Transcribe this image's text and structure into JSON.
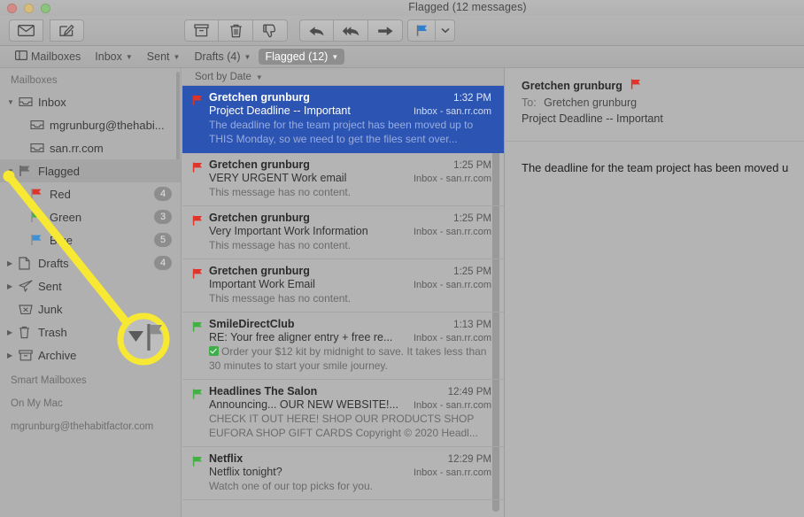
{
  "window": {
    "title": "Flagged (12 messages)",
    "traffic_lights": [
      "close-button",
      "minimize-button",
      "zoom-button"
    ]
  },
  "toolbar": {
    "groups": [
      {
        "name": "mail-actions",
        "buttons": [
          {
            "name": "get-mail-button",
            "icon": "envelope-icon",
            "label": "Get Mail"
          },
          {
            "name": "compose-button",
            "icon": "compose-icon",
            "label": "New Message"
          }
        ]
      },
      {
        "name": "message-actions",
        "buttons": [
          {
            "name": "archive-button",
            "icon": "archive-icon",
            "label": "Archive"
          },
          {
            "name": "delete-button",
            "icon": "trash-icon",
            "label": "Delete"
          },
          {
            "name": "junk-button",
            "icon": "thumbs-down-icon",
            "label": "Junk"
          }
        ]
      },
      {
        "name": "reply-actions",
        "buttons": [
          {
            "name": "reply-button",
            "icon": "reply-arrow-icon",
            "label": "Reply"
          },
          {
            "name": "reply-all-button",
            "icon": "reply-all-arrow-icon",
            "label": "Reply All"
          },
          {
            "name": "forward-button",
            "icon": "forward-arrow-icon",
            "label": "Forward"
          }
        ]
      },
      {
        "name": "flag-actions",
        "buttons": [
          {
            "name": "flag-button",
            "icon": "blue-flag-icon",
            "label": "Flag"
          },
          {
            "name": "flag-dropdown-button",
            "icon": "chevron-down-icon",
            "label": "Flag options"
          }
        ]
      }
    ]
  },
  "favorites_bar": {
    "items": [
      {
        "label": "Mailboxes",
        "icon": "sidebar-toggle-icon",
        "has_chevron": false,
        "active": false
      },
      {
        "label": "Inbox",
        "icon": "",
        "has_chevron": true,
        "active": false
      },
      {
        "label": "Sent",
        "icon": "",
        "has_chevron": true,
        "active": false
      },
      {
        "label": "Drafts (4)",
        "icon": "",
        "has_chevron": true,
        "active": false
      },
      {
        "label": "Flagged (12)",
        "icon": "",
        "has_chevron": true,
        "active": true
      }
    ]
  },
  "sidebar": {
    "header": "Mailboxes",
    "items": [
      {
        "label": "Inbox",
        "icon": "inbox-icon",
        "triangle": "down",
        "indent": 0,
        "badge": "",
        "selected": false
      },
      {
        "label": "mgrunburg@thehabi...",
        "icon": "inbox-icon",
        "triangle": "none",
        "indent": 1,
        "badge": "",
        "selected": false
      },
      {
        "label": "san.rr.com",
        "icon": "inbox-icon",
        "triangle": "none",
        "indent": 1,
        "badge": "",
        "selected": false
      },
      {
        "label": "Flagged",
        "icon": "flag-gray-icon",
        "triangle": "down",
        "indent": 0,
        "badge": "",
        "selected": true
      },
      {
        "label": "Red",
        "icon": "flag-red-icon",
        "triangle": "none",
        "indent": 1,
        "badge": "4",
        "selected": false
      },
      {
        "label": "Green",
        "icon": "flag-green-icon",
        "triangle": "none",
        "indent": 1,
        "badge": "3",
        "selected": false
      },
      {
        "label": "Blue",
        "icon": "flag-blue-icon",
        "triangle": "none",
        "indent": 1,
        "badge": "5",
        "selected": false
      },
      {
        "label": "Drafts",
        "icon": "drafts-icon",
        "triangle": "right",
        "indent": 0,
        "badge": "4",
        "selected": false
      },
      {
        "label": "Sent",
        "icon": "sent-icon",
        "triangle": "right",
        "indent": 0,
        "badge": "",
        "selected": false
      },
      {
        "label": "Junk",
        "icon": "junk-icon",
        "triangle": "none",
        "indent": 0,
        "badge": "",
        "selected": false
      },
      {
        "label": "Trash",
        "icon": "trash-icon",
        "triangle": "right",
        "indent": 0,
        "badge": "",
        "selected": false
      },
      {
        "label": "Archive",
        "icon": "archive-icon",
        "triangle": "right",
        "indent": 0,
        "badge": "",
        "selected": false
      }
    ],
    "groups": [
      {
        "label": "Smart Mailboxes"
      },
      {
        "label": "On My Mac"
      },
      {
        "label": "mgrunburg@thehabitfactor.com"
      }
    ]
  },
  "message_list": {
    "sort_label": "Sort by Date",
    "messages": [
      {
        "from": "Gretchen grunburg",
        "time": "1:32 PM",
        "subject": "Project Deadline -- Important",
        "mailbox": "Inbox - san.rr.com",
        "preview": "The deadline for the team project has been moved up to THIS Monday, so we need to get the files sent over...",
        "flag": "red",
        "selected": true,
        "has_check": false
      },
      {
        "from": "Gretchen grunburg",
        "time": "1:25 PM",
        "subject": "VERY URGENT Work email",
        "mailbox": "Inbox - san.rr.com",
        "preview": "This message has no content.",
        "flag": "red",
        "selected": false,
        "has_check": false
      },
      {
        "from": "Gretchen grunburg",
        "time": "1:25 PM",
        "subject": "Very Important Work Information",
        "mailbox": "Inbox - san.rr.com",
        "preview": "This message has no content.",
        "flag": "red",
        "selected": false,
        "has_check": false
      },
      {
        "from": "Gretchen grunburg",
        "time": "1:25 PM",
        "subject": "Important Work Email",
        "mailbox": "Inbox - san.rr.com",
        "preview": "This message has no content.",
        "flag": "red",
        "selected": false,
        "has_check": false
      },
      {
        "from": "SmileDirectClub",
        "time": "1:13 PM",
        "subject": "RE: Your free aligner entry + free re...",
        "mailbox": "Inbox - san.rr.com",
        "preview": "Order your $12 kit by midnight to save. It takes less than 30 minutes to start your smile journey.",
        "flag": "green",
        "selected": false,
        "has_check": true
      },
      {
        "from": "Headlines The Salon",
        "time": "12:49 PM",
        "subject": "Announcing... OUR NEW WEBSITE!...",
        "mailbox": "Inbox - san.rr.com",
        "preview": "CHECK IT OUT HERE! SHOP OUR PRODUCTS SHOP EUFORA SHOP GIFT CARDS Copyright © 2020 Headl...",
        "flag": "green",
        "selected": false,
        "has_check": false
      },
      {
        "from": "Netflix",
        "time": "12:29 PM",
        "subject": "Netflix tonight?",
        "mailbox": "Inbox - san.rr.com",
        "preview": "Watch one of our top picks for you.",
        "flag": "green",
        "selected": false,
        "has_check": false
      }
    ]
  },
  "reading_pane": {
    "from": "Gretchen grunburg",
    "flag": "red-flag-icon",
    "to_label": "To:",
    "to": "Gretchen grunburg",
    "subject": "Project Deadline -- Important",
    "body": "The deadline for the team project has been moved u"
  },
  "annotation": {
    "highlight_color": "#f7e833",
    "magnifier_contents": "disclosure-triangle-and-flag"
  },
  "colors": {
    "selection_blue": "#2c54b3",
    "flag_red": "#e0342b",
    "flag_green": "#43b043",
    "flag_blue": "#3d8fd6",
    "window_bg": "#b3b3b3"
  }
}
